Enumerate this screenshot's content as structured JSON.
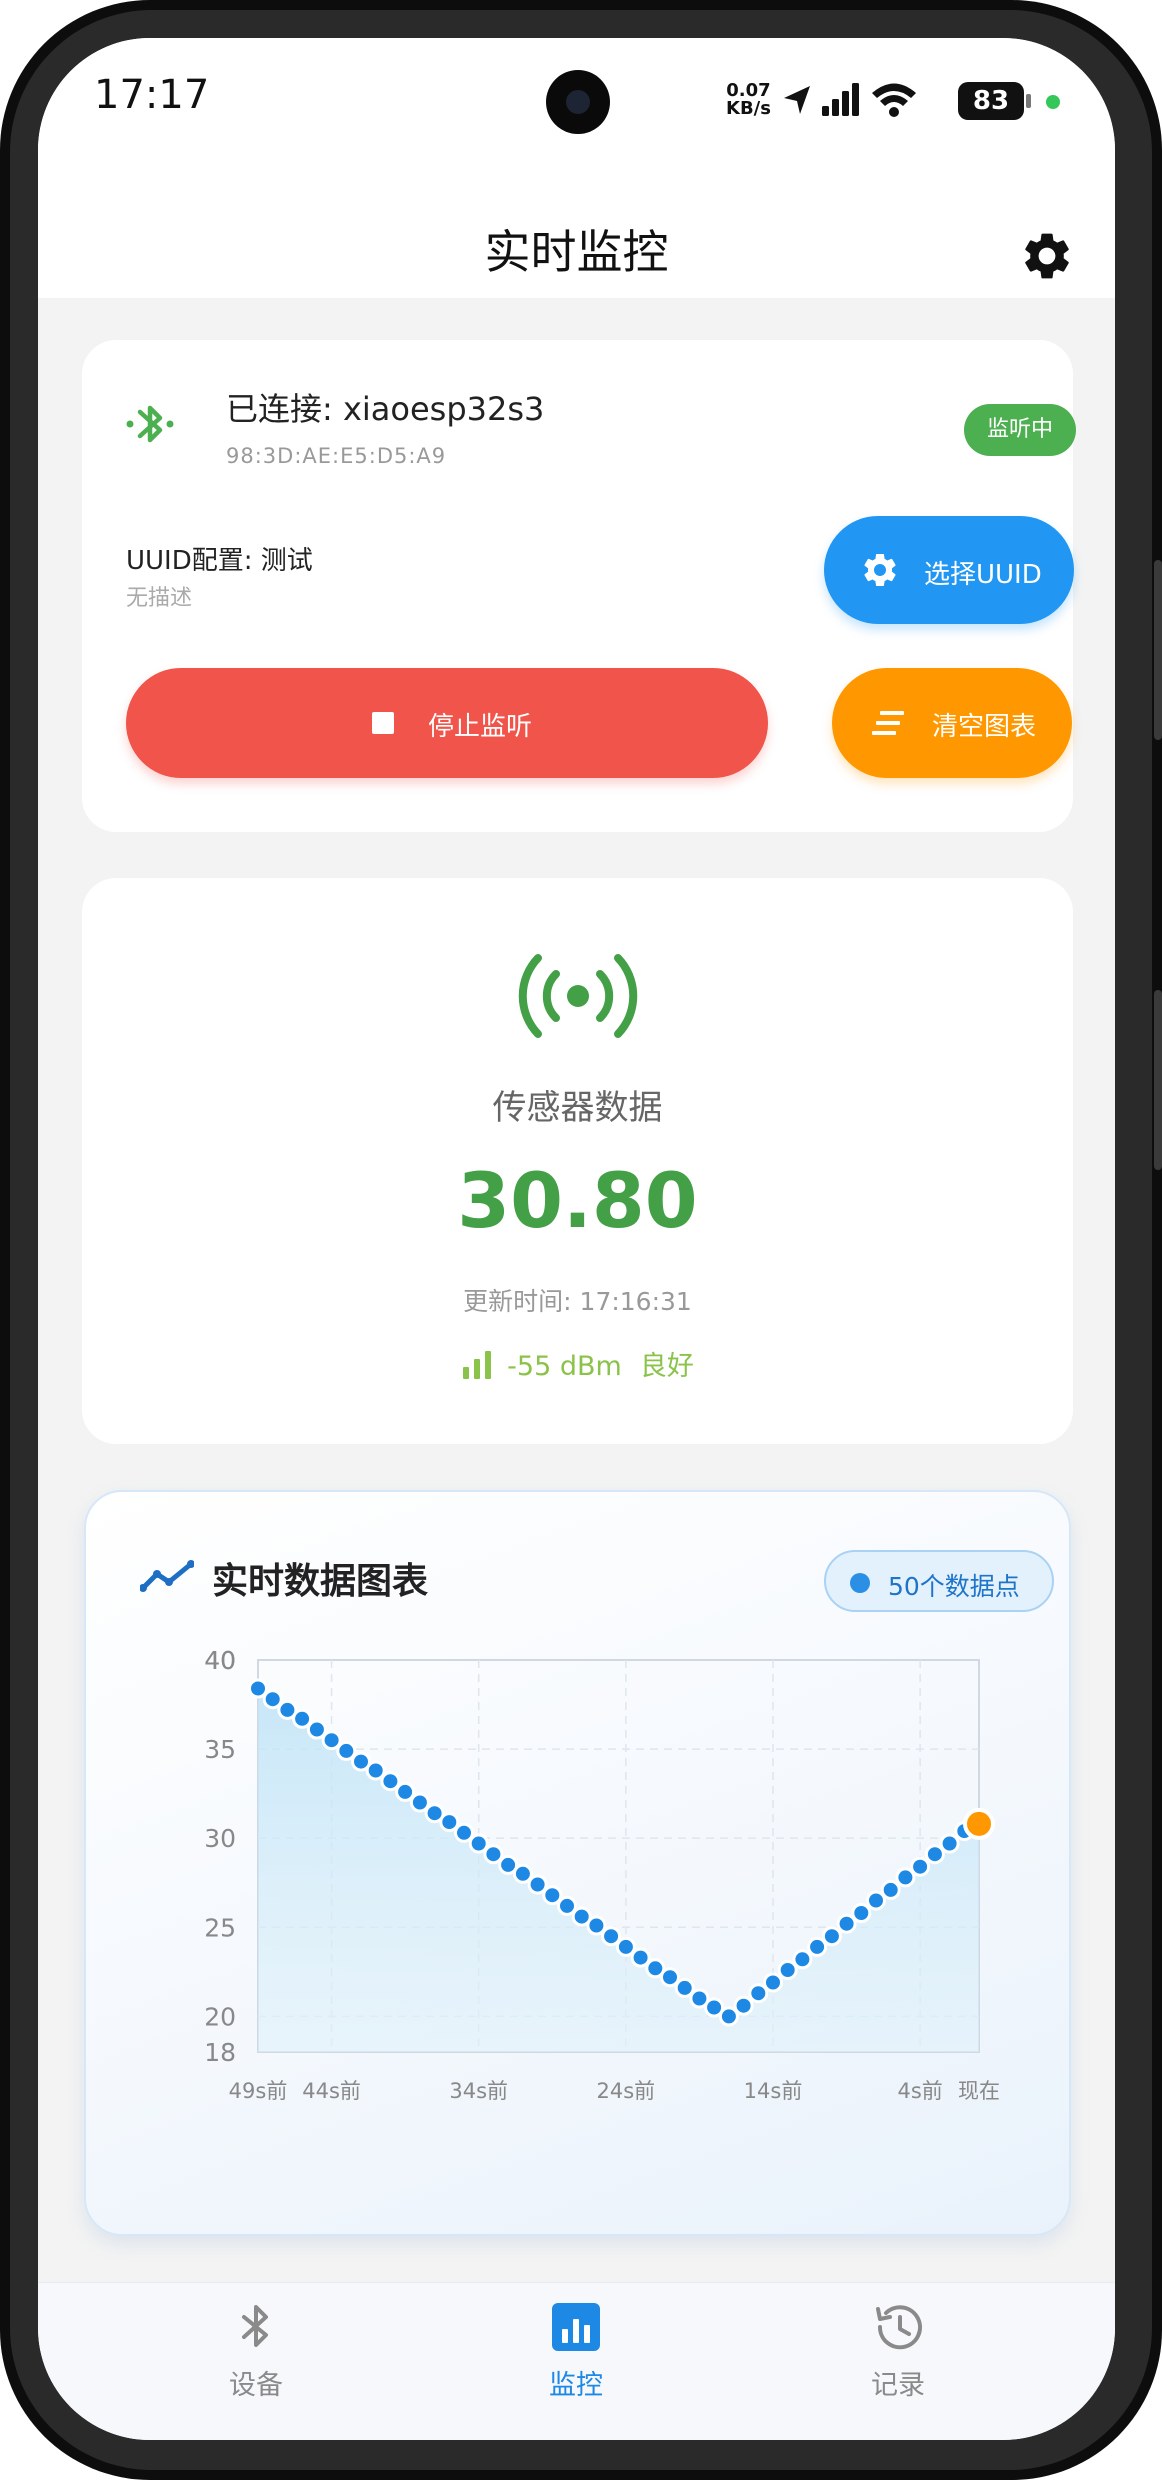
{
  "status_bar": {
    "time": "17:17",
    "net_speed_value": "0.07",
    "net_speed_unit": "KB/s",
    "battery": "83"
  },
  "app_bar": {
    "title": "实时监控",
    "settings_icon": "gear-icon"
  },
  "connection": {
    "status_text": "已连接: xiaoesp32s3",
    "mac": "98:3D:AE:E5:D5:A9",
    "listening_badge": "监听中",
    "uuid_config_label": "UUID配置: 测试",
    "uuid_description": "无描述",
    "select_uuid_button": "选择UUID",
    "stop_button": "停止监听",
    "clear_button": "清空图表",
    "colors": {
      "bluetooth": "#4caf50",
      "select": "#2196f3",
      "stop": "#f0544a",
      "clear": "#ff9800"
    }
  },
  "sensor": {
    "label": "传感器数据",
    "value": "30.80",
    "update_time": "更新时间: 17:16:31",
    "rssi": "-55 dBm",
    "signal_quality": "良好",
    "value_color": "#43a047"
  },
  "chart_card": {
    "title": "实时数据图表",
    "points_badge": "50个数据点"
  },
  "chart_data": {
    "type": "line",
    "title": "实时数据图表",
    "x_tick_labels": [
      "49s前",
      "44s前",
      "34s前",
      "24s前",
      "14s前",
      "4s前",
      "现在"
    ],
    "x_tick_seconds_ago": [
      49,
      44,
      34,
      24,
      14,
      4,
      0
    ],
    "y_tick_labels": [
      "18",
      "20",
      "25",
      "30",
      "35",
      "40",
      "40"
    ],
    "y_ticks": [
      18,
      20,
      25,
      30,
      35,
      40,
      40
    ],
    "ylim": [
      18,
      40
    ],
    "xlim_seconds_ago": [
      49,
      0
    ],
    "grid": true,
    "area_fill": true,
    "series": [
      {
        "values": [
          38.4,
          37.8,
          37.2,
          36.7,
          36.1,
          35.5,
          34.9,
          34.3,
          33.8,
          33.2,
          32.6,
          32.0,
          31.4,
          30.9,
          30.3,
          29.7,
          29.1,
          28.5,
          28.0,
          27.4,
          26.8,
          26.2,
          25.6,
          25.1,
          24.5,
          23.9,
          23.3,
          22.7,
          22.2,
          21.6,
          21.0,
          20.5,
          20.0,
          20.6,
          21.3,
          21.9,
          22.6,
          23.2,
          23.9,
          24.5,
          25.2,
          25.8,
          26.5,
          27.1,
          27.8,
          28.4,
          29.1,
          29.7,
          30.4,
          30.8
        ],
        "color": "#1e88e5",
        "last_point_color": "#ff9800"
      }
    ]
  },
  "bottom_nav": {
    "items": [
      {
        "label": "设备",
        "icon": "bluetooth-icon"
      },
      {
        "label": "监控",
        "icon": "bar-chart-icon"
      },
      {
        "label": "记录",
        "icon": "history-icon"
      }
    ],
    "active_color": "#1e88e5"
  }
}
